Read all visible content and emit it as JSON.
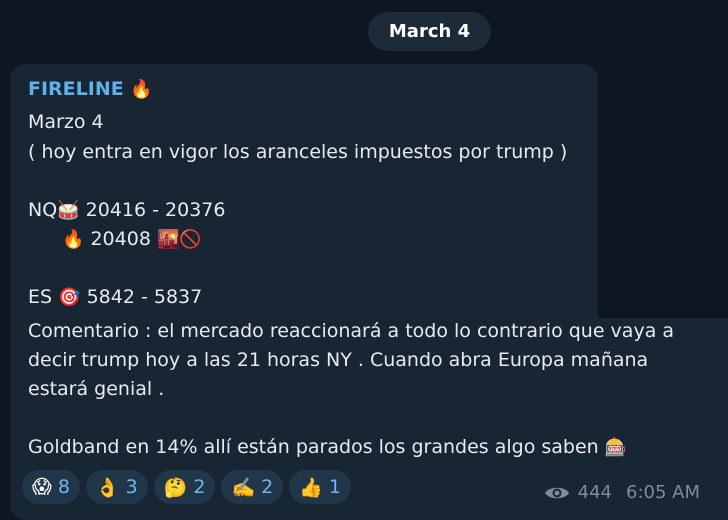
{
  "date_pill": "March 4",
  "message": {
    "sender": "FIRELINE",
    "lines": {
      "l1": "Marzo 4",
      "l2": "( hoy entra en vigor los aranceles impuestos por trump )",
      "nq_label": "NQ",
      "nq_range": "20416 - 20376",
      "nq_level": "20408",
      "es_label": "ES",
      "es_range": "5842 - 5837",
      "comment1": "Comentario : el mercado reaccionará a todo lo contrario que vaya a",
      "comment2": "decir trump hoy a las 21 horas NY . Cuando abra Europa mañana",
      "comment3": "estará genial .",
      "goldband": "Goldband en 14% allí están parados los grandes algo saben"
    },
    "emojis": {
      "fire": "🔥",
      "drum": "🥁",
      "sunrise": "🌇",
      "prohibited": "🚫",
      "target": "🎯",
      "slot": "🎰"
    }
  },
  "reactions": [
    {
      "emoji": "😱",
      "count": "8"
    },
    {
      "emoji": "👌",
      "count": "3"
    },
    {
      "emoji": "🤔",
      "count": "2"
    },
    {
      "emoji": "✍️",
      "count": "2"
    },
    {
      "emoji": "👍",
      "count": "1"
    }
  ],
  "footer": {
    "views": "444",
    "time": "6:05 AM"
  }
}
